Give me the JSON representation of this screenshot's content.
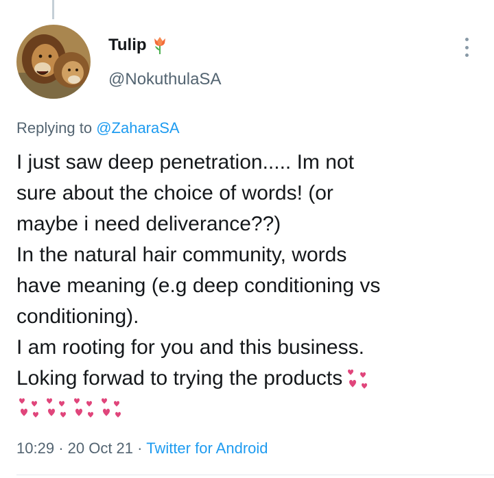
{
  "author": {
    "display_name": "Tulip",
    "name_emoji": "tulip-icon",
    "handle": "@NokuthulaSA",
    "avatar": "lions-avatar"
  },
  "reply": {
    "prefix": "Replying to",
    "target_handle": "@ZaharaSA"
  },
  "tweet": {
    "lines": [
      "I just saw deep penetration..... Im not",
      "sure about the choice of words! (or",
      "maybe i need deliverance??)",
      "In the natural hair community, words",
      "have meaning (e.g deep conditioning vs",
      "conditioning).",
      "I am rooting for you and this business.",
      "Loking forwad to trying the products"
    ],
    "trailing_emoji": "revolving-hearts-icon",
    "emoji_row_count": 4
  },
  "meta": {
    "time": "10:29",
    "separator": "·",
    "date": "20 Oct 21",
    "source": "Twitter for Android"
  },
  "colors": {
    "link": "#1d9bf0",
    "secondary_text": "#536471",
    "primary_text": "#14171a",
    "heart": "#e0457b"
  }
}
